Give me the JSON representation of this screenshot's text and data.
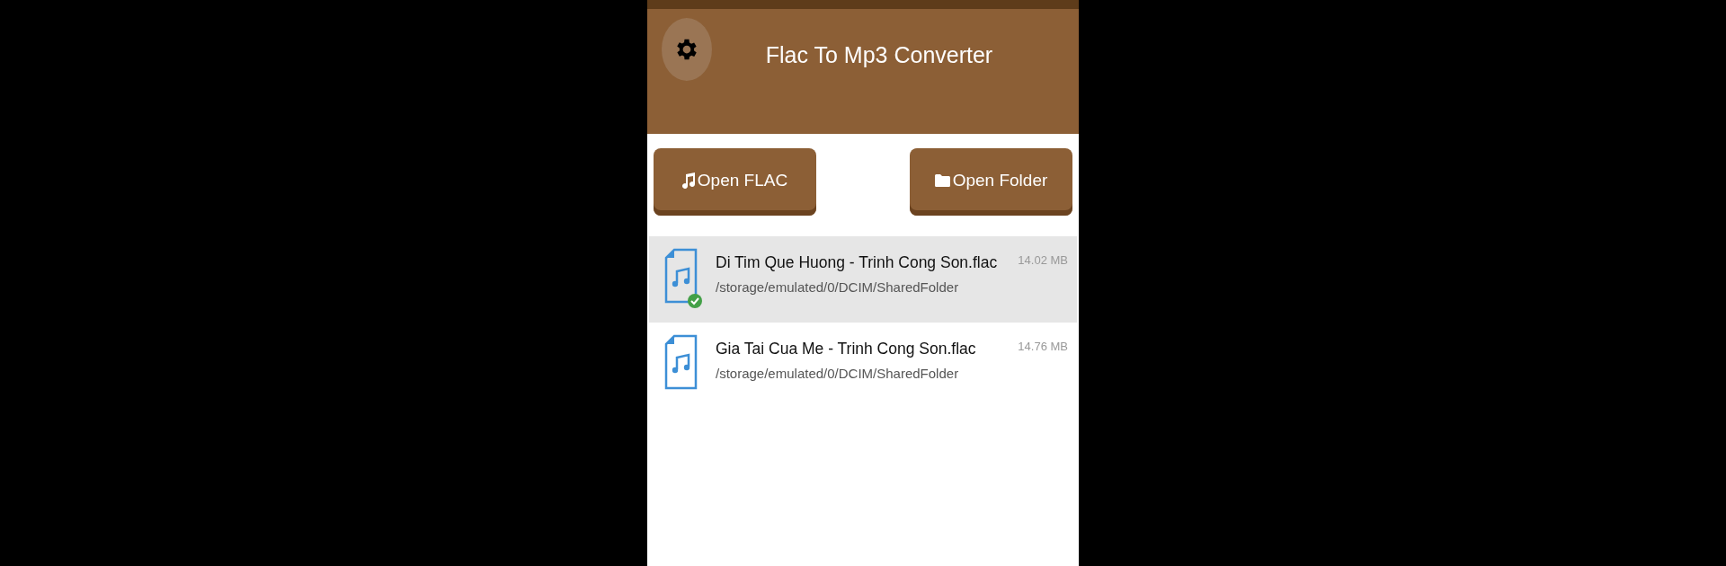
{
  "app_bar": {
    "title": "Flac To Mp3 Converter"
  },
  "buttons": [
    {
      "kind": "music",
      "label": "Open FLAC"
    },
    {
      "kind": "folder",
      "label": "Open Folder"
    }
  ],
  "files": [
    {
      "name": "Di Tim Que Huong - Trinh Cong Son.flac",
      "path": "/storage/emulated/0/DCIM/SharedFolder",
      "size": "14.02 MB",
      "selected": true,
      "converted": true
    },
    {
      "name": "Gia Tai Cua Me - Trinh Cong Son.flac",
      "path": "/storage/emulated/0/DCIM/SharedFolder",
      "size": "14.76 MB",
      "selected": false,
      "converted": false
    }
  ]
}
